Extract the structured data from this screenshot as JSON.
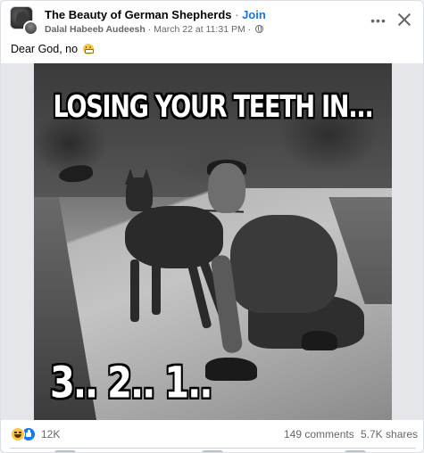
{
  "header": {
    "group_name": "The Beauty of German Shepherds",
    "separator": " · ",
    "join_label": "Join",
    "author": "Dalal Habeeb Audeesh",
    "meta_separator": " · ",
    "timestamp": "March 22 at 11:31 PM",
    "meta_separator2": " · ",
    "privacy_icon": "globe-icon",
    "more_icon": "more-horizontal-icon",
    "close_icon": "close-icon"
  },
  "post": {
    "caption": "Dear God, no",
    "caption_emoji": "grimacing-face-emoji"
  },
  "meme": {
    "top_text": "LOSING YOUR TEETH IN...",
    "bottom_text": "3.. 2.. 1.."
  },
  "footer": {
    "reaction_icons": [
      "haha-icon",
      "like-icon"
    ],
    "reaction_count": "12K",
    "comments": "149 comments",
    "shares": "5.7K shares"
  },
  "colors": {
    "link_blue": "#1b74e4",
    "secondary_text": "#65676b",
    "like_blue": "#1877f2",
    "haha_yellow": "#f7c948"
  }
}
